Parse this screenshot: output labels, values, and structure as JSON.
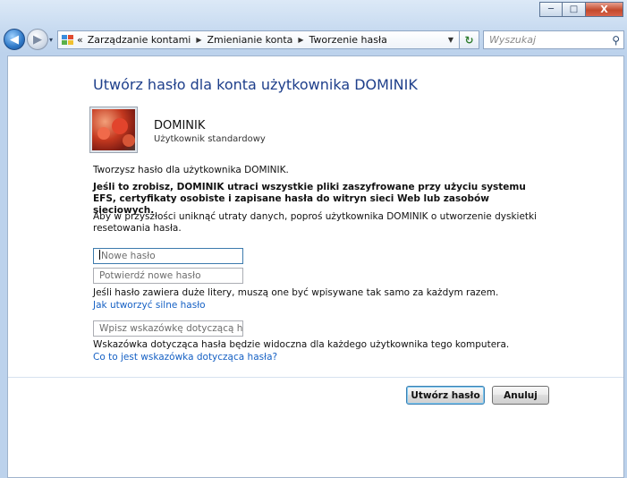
{
  "window": {
    "controls": {
      "minimize": "─",
      "maximize": "□",
      "close": "X"
    }
  },
  "nav": {
    "back": "◀",
    "forward": "▶",
    "dropdown": "▾"
  },
  "address": {
    "prefix": "«",
    "breadcrumbs": [
      "Zarządzanie kontami",
      "Zmienianie konta",
      "Tworzenie hasła"
    ],
    "separator": "▶",
    "chevron": "▼",
    "refresh": "↻",
    "icon_colors": [
      "#3a8dde",
      "#e04a2f",
      "#5ab04a",
      "#f0c030"
    ]
  },
  "search": {
    "placeholder": "Wyszukaj"
  },
  "page": {
    "title": "Utwórz hasło dla konta użytkownika DOMINIK",
    "user": {
      "name": "DOMINIK",
      "type": "Użytkownik standardowy"
    },
    "intro": "Tworzysz hasło dla użytkownika DOMINIK.",
    "warning": "Jeśli to zrobisz, DOMINIK utraci wszystkie pliki zaszyfrowane przy użyciu systemu EFS, certyfikaty osobiste i zapisane hasła do witryn sieci Web lub zasobów sieciowych.",
    "reset_note": "Aby w przyszłości uniknąć utraty danych, poproś użytkownika DOMINIK o utworzenie dyskietki resetowania hasła.",
    "fields": {
      "new_password": {
        "placeholder": "Nowe hasło",
        "value": ""
      },
      "confirm_password": {
        "placeholder": "Potwierdź nowe hasło",
        "value": ""
      },
      "hint": {
        "placeholder": "Wpisz wskazówkę dotyczącą hasła",
        "value": ""
      }
    },
    "case_note": "Jeśli hasło zawiera duże litery, muszą one być wpisywane tak samo za każdym razem.",
    "strong_link": "Jak utworzyć silne hasło",
    "hint_note": "Wskazówka dotycząca hasła będzie widoczna dla każdego użytkownika tego komputera.",
    "hint_link": "Co to jest wskazówka dotycząca hasła?",
    "buttons": {
      "create": "Utwórz hasło",
      "cancel": "Anuluj"
    }
  },
  "colors": {
    "title_blue": "#1e3f8b",
    "link_blue": "#1560c4"
  }
}
